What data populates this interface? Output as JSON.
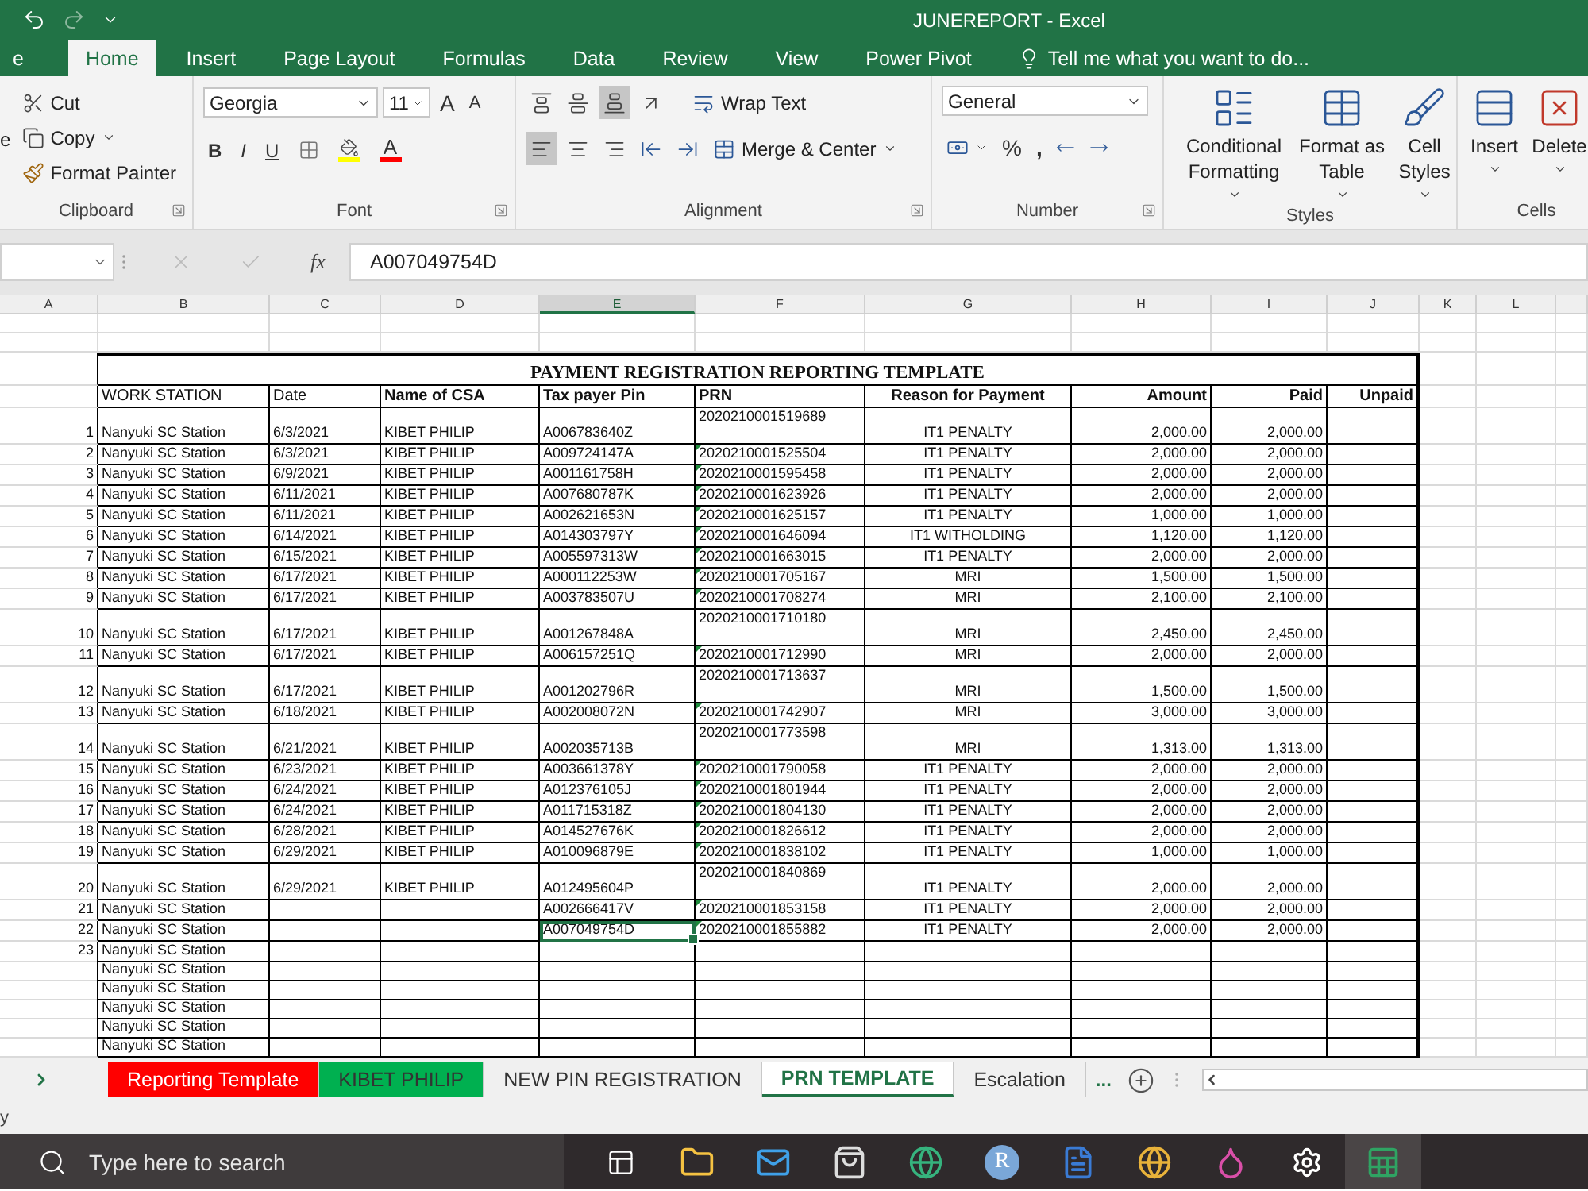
{
  "title_bar": {
    "title": "JUNEREPORT - Excel"
  },
  "ribbon_tabs": [
    {
      "label": "e",
      "selected": false
    },
    {
      "label": "Home",
      "selected": true
    },
    {
      "label": "Insert",
      "selected": false
    },
    {
      "label": "Page Layout",
      "selected": false
    },
    {
      "label": "Formulas",
      "selected": false
    },
    {
      "label": "Data",
      "selected": false
    },
    {
      "label": "Review",
      "selected": false
    },
    {
      "label": "View",
      "selected": false
    },
    {
      "label": "Power Pivot",
      "selected": false
    }
  ],
  "tell_me": "Tell me what you want to do...",
  "clipboard": {
    "paste_partial": "e",
    "cut": "Cut",
    "copy": "Copy",
    "format_painter": "Format Painter",
    "label": "Clipboard"
  },
  "font": {
    "name": "Georgia",
    "size": "11",
    "grow": "A",
    "shrink": "A",
    "bold": "B",
    "italic": "I",
    "underline": "U",
    "color_letter": "A",
    "label": "Font"
  },
  "alignment": {
    "vertical": [
      {
        "kind": "top",
        "selected": false
      },
      {
        "kind": "middle",
        "selected": false
      },
      {
        "kind": "bottom",
        "selected": true
      }
    ],
    "horizontal": [
      {
        "kind": "left",
        "selected": true
      },
      {
        "kind": "center",
        "selected": false
      },
      {
        "kind": "right",
        "selected": false
      }
    ],
    "wrap_text": "Wrap Text",
    "merge": "Merge & Center",
    "label": "Alignment"
  },
  "number": {
    "format": "General",
    "percent": "%",
    "comma": ",",
    "label": "Number"
  },
  "styles": {
    "buttons": [
      "Conditional Formatting",
      "Format as Table",
      "Cell Styles"
    ],
    "label": "Styles"
  },
  "cells": {
    "buttons": [
      "Insert",
      "Delete"
    ],
    "label": "Cells"
  },
  "formula_bar": {
    "fx": "fx",
    "value": "A007049754D"
  },
  "columns": [
    {
      "label": "A",
      "selected": false
    },
    {
      "label": "B",
      "selected": false
    },
    {
      "label": "C",
      "selected": false
    },
    {
      "label": "D",
      "selected": false
    },
    {
      "label": "E",
      "selected": true
    },
    {
      "label": "F",
      "selected": false
    },
    {
      "label": "G",
      "selected": false
    },
    {
      "label": "H",
      "selected": false
    },
    {
      "label": "I",
      "selected": false
    },
    {
      "label": "J",
      "selected": false
    },
    {
      "label": "K",
      "selected": false
    },
    {
      "label": "L",
      "selected": false
    }
  ],
  "sheet": {
    "title": "PAYMENT REGISTRATION REPORTING TEMPLATE",
    "headers": [
      "WORK STATION",
      "Date",
      "Name of CSA",
      "Tax payer Pin",
      "PRN",
      "Reason for Payment",
      "Amount",
      "Paid",
      "Unpaid"
    ],
    "rows": [
      {
        "n": "1",
        "station": "Nanyuki SC Station",
        "date": "6/3/2021",
        "csa": "KIBET PHILIP",
        "pin": "A006783640Z",
        "prn": "2020210001519689",
        "reason": "IT1 PENALTY",
        "amount": "2,000.00",
        "paid": "2,000.00",
        "kind": "wrapped",
        "flagged": false,
        "pin_selected": false
      },
      {
        "n": "2",
        "station": "Nanyuki SC Station",
        "date": "6/3/2021",
        "csa": "KIBET PHILIP",
        "pin": "A009724147A",
        "prn": "2020210001525504",
        "reason": "IT1 PENALTY",
        "amount": "2,000.00",
        "paid": "2,000.00",
        "kind": "plain",
        "flagged": true,
        "pin_selected": false
      },
      {
        "n": "3",
        "station": "Nanyuki SC Station",
        "date": "6/9/2021",
        "csa": "KIBET PHILIP",
        "pin": "A001161758H",
        "prn": "2020210001595458",
        "reason": "IT1 PENALTY",
        "amount": "2,000.00",
        "paid": "2,000.00",
        "kind": "plain",
        "flagged": true,
        "pin_selected": false
      },
      {
        "n": "4",
        "station": "Nanyuki SC Station",
        "date": "6/11/2021",
        "csa": "KIBET PHILIP",
        "pin": "A007680787K",
        "prn": "2020210001623926",
        "reason": "IT1 PENALTY",
        "amount": "2,000.00",
        "paid": "2,000.00",
        "kind": "plain",
        "flagged": true,
        "pin_selected": false
      },
      {
        "n": "5",
        "station": "Nanyuki SC Station",
        "date": "6/11/2021",
        "csa": "KIBET PHILIP",
        "pin": "A002621653N",
        "prn": "2020210001625157",
        "reason": "IT1 PENALTY",
        "amount": "1,000.00",
        "paid": "1,000.00",
        "kind": "plain",
        "flagged": true,
        "pin_selected": false
      },
      {
        "n": "6",
        "station": "Nanyuki SC Station",
        "date": "6/14/2021",
        "csa": "KIBET PHILIP",
        "pin": "A014303797Y",
        "prn": "2020210001646094",
        "reason": "IT1 WITHOLDING",
        "amount": "1,120.00",
        "paid": "1,120.00",
        "kind": "plain",
        "flagged": true,
        "pin_selected": false
      },
      {
        "n": "7",
        "station": "Nanyuki SC Station",
        "date": "6/15/2021",
        "csa": "KIBET PHILIP",
        "pin": "A005597313W",
        "prn": "2020210001663015",
        "reason": "IT1 PENALTY",
        "amount": "2,000.00",
        "paid": "2,000.00",
        "kind": "plain",
        "flagged": true,
        "pin_selected": false
      },
      {
        "n": "8",
        "station": "Nanyuki SC Station",
        "date": "6/17/2021",
        "csa": "KIBET PHILIP",
        "pin": "A000112253W",
        "prn": "2020210001705167",
        "reason": "MRI",
        "amount": "1,500.00",
        "paid": "1,500.00",
        "kind": "plain",
        "flagged": true,
        "pin_selected": false
      },
      {
        "n": "9",
        "station": "Nanyuki SC Station",
        "date": "6/17/2021",
        "csa": "KIBET PHILIP",
        "pin": "A003783507U",
        "prn": "2020210001708274",
        "reason": "MRI",
        "amount": "2,100.00",
        "paid": "2,100.00",
        "kind": "plain",
        "flagged": true,
        "pin_selected": false
      },
      {
        "n": "10",
        "station": "Nanyuki SC Station",
        "date": "6/17/2021",
        "csa": "KIBET PHILIP",
        "pin": "A001267848A",
        "prn": "2020210001710180",
        "reason": "MRI",
        "amount": "2,450.00",
        "paid": "2,450.00",
        "kind": "wrapped",
        "flagged": false,
        "pin_selected": false
      },
      {
        "n": "11",
        "station": "Nanyuki SC Station",
        "date": "6/17/2021",
        "csa": "KIBET PHILIP",
        "pin": "A006157251Q",
        "prn": "2020210001712990",
        "reason": "MRI",
        "amount": "2,000.00",
        "paid": "2,000.00",
        "kind": "plain",
        "flagged": true,
        "pin_selected": false
      },
      {
        "n": "12",
        "station": "Nanyuki SC Station",
        "date": "6/17/2021",
        "csa": "KIBET PHILIP",
        "pin": "A001202796R",
        "prn": "2020210001713637",
        "reason": "MRI",
        "amount": "1,500.00",
        "paid": "1,500.00",
        "kind": "wrapped",
        "flagged": false,
        "pin_selected": false
      },
      {
        "n": "13",
        "station": "Nanyuki SC Station",
        "date": "6/18/2021",
        "csa": "KIBET PHILIP",
        "pin": "A002008072N",
        "prn": "2020210001742907",
        "reason": "MRI",
        "amount": "3,000.00",
        "paid": "3,000.00",
        "kind": "plain",
        "flagged": true,
        "pin_selected": false
      },
      {
        "n": "14",
        "station": "Nanyuki SC Station",
        "date": "6/21/2021",
        "csa": "KIBET PHILIP",
        "pin": "A002035713B",
        "prn": "2020210001773598",
        "reason": "MRI",
        "amount": "1,313.00",
        "paid": "1,313.00",
        "kind": "wrapped",
        "flagged": false,
        "pin_selected": false
      },
      {
        "n": "15",
        "station": "Nanyuki SC Station",
        "date": "6/23/2021",
        "csa": "KIBET PHILIP",
        "pin": "A003661378Y",
        "prn": "2020210001790058",
        "reason": "IT1 PENALTY",
        "amount": "2,000.00",
        "paid": "2,000.00",
        "kind": "plain",
        "flagged": true,
        "pin_selected": false
      },
      {
        "n": "16",
        "station": "Nanyuki SC Station",
        "date": "6/24/2021",
        "csa": "KIBET PHILIP",
        "pin": "A012376105J",
        "prn": "2020210001801944",
        "reason": "IT1 PENALTY",
        "amount": "2,000.00",
        "paid": "2,000.00",
        "kind": "plain",
        "flagged": true,
        "pin_selected": false
      },
      {
        "n": "17",
        "station": "Nanyuki SC Station",
        "date": "6/24/2021",
        "csa": "KIBET PHILIP",
        "pin": "A011715318Z",
        "prn": "2020210001804130",
        "reason": "IT1 PENALTY",
        "amount": "2,000.00",
        "paid": "2,000.00",
        "kind": "plain",
        "flagged": true,
        "pin_selected": false
      },
      {
        "n": "18",
        "station": "Nanyuki SC Station",
        "date": "6/28/2021",
        "csa": "KIBET PHILIP",
        "pin": "A014527676K",
        "prn": "2020210001826612",
        "reason": "IT1 PENALTY",
        "amount": "2,000.00",
        "paid": "2,000.00",
        "kind": "plain",
        "flagged": true,
        "pin_selected": false
      },
      {
        "n": "19",
        "station": "Nanyuki SC Station",
        "date": "6/29/2021",
        "csa": "KIBET PHILIP",
        "pin": "A010096879E",
        "prn": "2020210001838102",
        "reason": "IT1 PENALTY",
        "amount": "1,000.00",
        "paid": "1,000.00",
        "kind": "plain",
        "flagged": true,
        "pin_selected": false
      },
      {
        "n": "20",
        "station": "Nanyuki SC Station",
        "date": "6/29/2021",
        "csa": "KIBET PHILIP",
        "pin": "A012495604P",
        "prn": "2020210001840869",
        "reason": "IT1 PENALTY",
        "amount": "2,000.00",
        "paid": "2,000.00",
        "kind": "wrapped",
        "flagged": false,
        "pin_selected": false
      },
      {
        "n": "21",
        "station": "Nanyuki SC Station",
        "pin": "A002666417V",
        "prn": "2020210001853158",
        "reason": "IT1 PENALTY",
        "amount": "2,000.00",
        "paid": "2,000.00",
        "kind": "plain",
        "flagged": true,
        "pin_selected": false
      },
      {
        "n": "22",
        "station": "Nanyuki SC Station",
        "pin": "A007049754D",
        "prn": "2020210001855882",
        "reason": "IT1 PENALTY",
        "amount": "2,000.00",
        "paid": "2,000.00",
        "kind": "plain",
        "flagged": true,
        "pin_selected": true
      },
      {
        "n": "23",
        "station": "Nanyuki SC Station",
        "kind": "short",
        "pin_selected": false
      },
      {
        "station": "Nanyuki SC Station",
        "kind": "short",
        "pin_selected": false
      },
      {
        "station": "Nanyuki SC Station",
        "kind": "short",
        "pin_selected": false
      },
      {
        "station": "Nanyuki SC Station",
        "kind": "short",
        "pin_selected": false
      },
      {
        "station": "Nanyuki SC Station",
        "kind": "short",
        "pin_selected": false
      },
      {
        "station": "Nanyuki SC Station",
        "kind": "short",
        "pin_selected": false
      }
    ]
  },
  "sheet_tabs": [
    {
      "label": "Reporting Template",
      "color": "#ff0000",
      "selected": false
    },
    {
      "label": "KIBET PHILIP",
      "color": "#00b050",
      "selected": false
    },
    {
      "label": "NEW PIN REGISTRATION",
      "selected": false
    },
    {
      "label": "PRN TEMPLATE",
      "selected": true
    },
    {
      "label": "Escalation",
      "selected": false
    }
  ],
  "more_tabs": "...",
  "status_bar": {
    "text": "y"
  },
  "taskbar": {
    "search_placeholder": "Type here to search",
    "avatar": "R"
  }
}
